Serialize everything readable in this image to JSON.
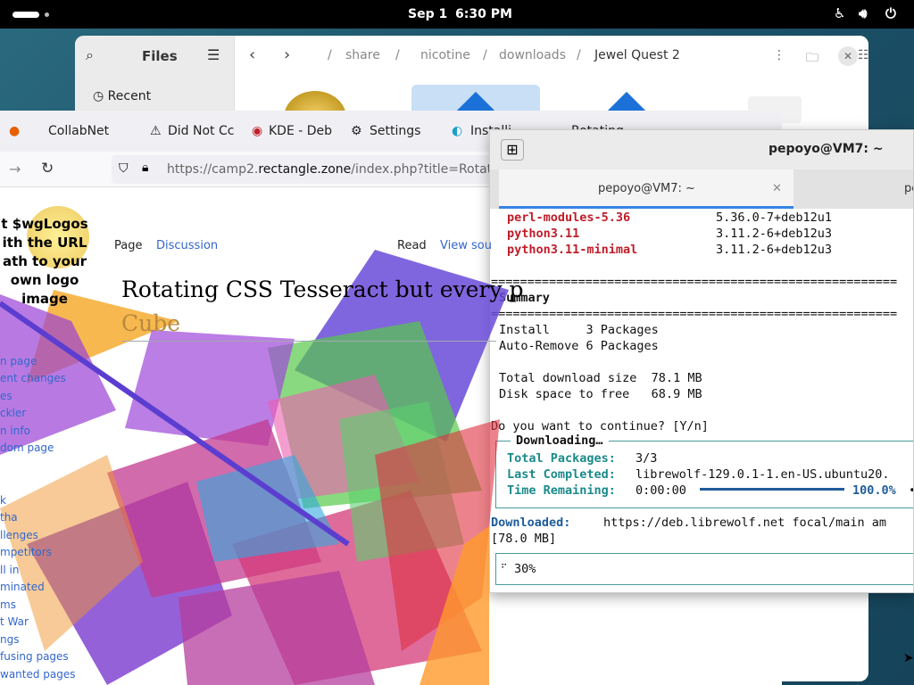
{
  "topbar": {
    "date": "Sep 1",
    "time": "6:30 PM"
  },
  "files": {
    "title": "Files",
    "recent": "Recent",
    "breadcrumbs": [
      "share",
      "nicotine",
      "downloads"
    ],
    "current_folder": "Jewel Quest 2",
    "separator": "/"
  },
  "browser": {
    "tabs": [
      "CollabNet",
      "Did Not Cc",
      "KDE - Deb",
      "Settings",
      "Installi",
      "Rotating"
    ],
    "url_prefix": "https://camp2.",
    "url_host": "rectangle.zone",
    "url_rest": "/index.php?title=Rotati",
    "logo_lines": [
      "t $wgLogos",
      "ith the URL",
      "ath to your",
      "own logo",
      "image"
    ],
    "wiki_tabs": {
      "page": "Page",
      "discussion": "Discussion",
      "read": "Read",
      "view_source": "View sou"
    },
    "title_line1": "Rotating CSS Tesseract but every p",
    "title_line2": "Cube",
    "sidebar_links": [
      "n page",
      "ent changes",
      "es",
      "ckler",
      "n info",
      "dom page",
      "k",
      "tha",
      "llenges",
      "mpetitors",
      "ll in",
      "minated",
      "ms",
      "t War",
      "ngs",
      "fusing pages",
      "wanted pages"
    ],
    "colors": {
      "link": "#3366cc",
      "cube": "#b78a3f"
    }
  },
  "terminal": {
    "title": "pepoyo@VM7: ~",
    "tab_label": "pepoyo@VM7: ~",
    "tab2_label": "pe",
    "packages": [
      {
        "name": "perl-modules-5.36",
        "version": "5.36.0-7+deb12u1"
      },
      {
        "name": "python3.11",
        "version": "3.11.2-6+deb12u3"
      },
      {
        "name": "python3.11-minimal",
        "version": "3.11.2-6+deb12u3"
      }
    ],
    "rule": "========================================================",
    "summary": "Summary",
    "install": "Install     3 Packages",
    "autoremove": "Auto-Remove 6 Packages",
    "download_size": "Total download size  78.1 MB",
    "disk_space": "Disk space to free   68.9 MB",
    "prompt": "Do you want to continue? [Y/n]",
    "downloading": "Downloading…",
    "total_label": "Total Packages:",
    "total_value": "3/3",
    "last_label": "Last Completed:",
    "last_value": "librewolf-129.0.1-1.en-US.ubuntu20.",
    "time_label": "Time Remaining:",
    "time_value": "0:00:00",
    "percent": "100.0%",
    "progress": 1.0,
    "downloaded_label": "Downloaded:",
    "downloaded_value": "https://deb.librewolf.net focal/main am",
    "downloaded_size": "[78.0 MB]",
    "spinner_percent": "30%"
  }
}
